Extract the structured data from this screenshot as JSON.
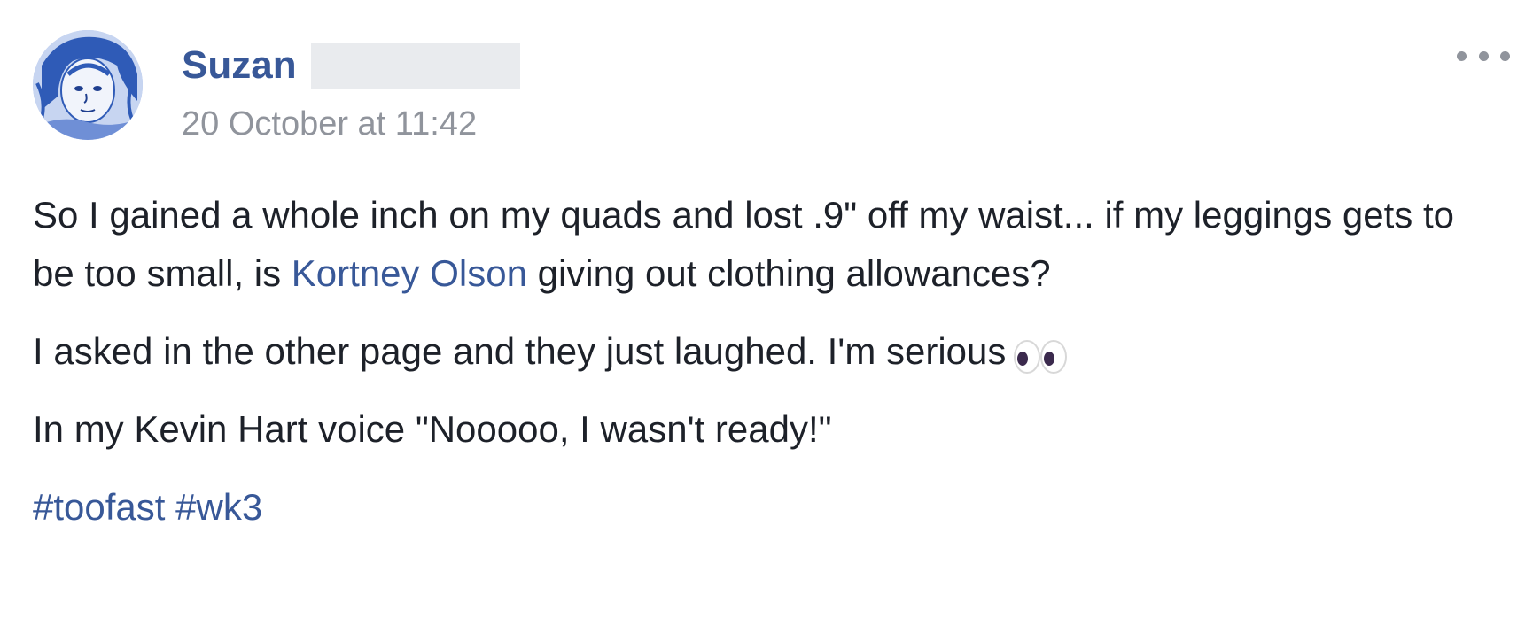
{
  "post": {
    "author_name": "Suzan",
    "timestamp": "20 October at 11:42",
    "more_options_icon": "ellipsis-horizontal-icon",
    "paragraphs": {
      "p1_before": "So I gained a whole inch on my quads and lost .9\" off my waist... if my leggings gets to be too small, is ",
      "p1_mention": "Kortney Olson",
      "p1_after": " giving out clothing allowances?",
      "p2": "I asked in the other page and they just laughed. I'm serious",
      "p2_emoji": "eyes-emoji-icon",
      "p3": "In my Kevin Hart voice \"Nooooo, I wasn't ready!\""
    },
    "hashtags": [
      "#toofast",
      "#wk3"
    ]
  },
  "colors": {
    "link": "#385898",
    "text": "#1d2129",
    "meta": "#90949c",
    "redaction": "#e9ebee"
  }
}
